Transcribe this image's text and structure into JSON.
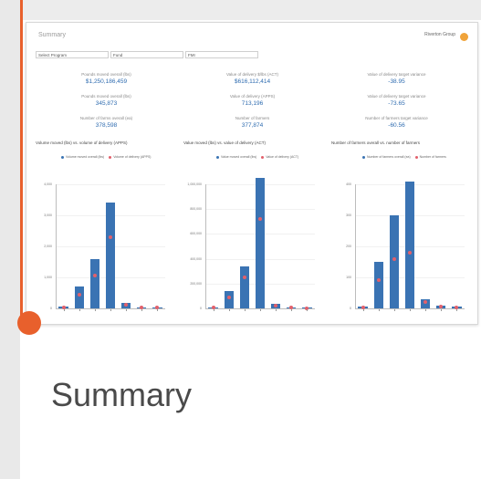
{
  "page": {
    "heading": "Summary"
  },
  "thumbnail": {
    "title": "Summary",
    "logo_text": "Riverton\nGroup",
    "filters": [
      {
        "label": "Select Program"
      },
      {
        "label": "Fund"
      },
      {
        "label": "FMI"
      }
    ],
    "kpis": [
      {
        "label": "Pounds moved overall (lbs)",
        "value": "$1,250,186,459"
      },
      {
        "label": "Value of delivery $/lbs (ACT)",
        "value": "$616,112,414"
      },
      {
        "label": "Value of delivery target variance",
        "value": "-38.95"
      },
      {
        "label": "Pounds moved overall (lbs)",
        "value": "345,873"
      },
      {
        "label": "Value of delivery (APPS)",
        "value": "713,196"
      },
      {
        "label": "Value of delivery target variance",
        "value": "-73.65"
      },
      {
        "label": "Number of farms overall (ea)",
        "value": "378,598"
      },
      {
        "label": "Number of farmers",
        "value": "377,874"
      },
      {
        "label": "Number of farmers target variance",
        "value": "-60.56"
      }
    ],
    "charts": [
      {
        "title": "Volume moved (lbs) vs. volume of delivery (APPS)",
        "legend": [
          "Volume moved overall (lbs)",
          "Volume of delivery (APPS)"
        ],
        "yticks": [
          "4,000",
          "3,000",
          "2,000",
          "1,000",
          "0"
        ]
      },
      {
        "title": "Value moved (lbs) vs. value of delivery (ACT)",
        "legend": [
          "Value moved overall (lbs)",
          "Value of delivery (ACT)"
        ],
        "yticks": [
          "1,000,000",
          "800,000",
          "600,000",
          "400,000",
          "200,000",
          "0"
        ]
      },
      {
        "title": "Number of farmers overall vs. number of farmers",
        "legend": [
          "Number of farmers overall (ea)",
          "Number of farmers"
        ],
        "yticks": [
          "400",
          "300",
          "200",
          "100",
          "0"
        ]
      }
    ],
    "chart_data": [
      {
        "type": "bar",
        "categories": [
          "1",
          "2",
          "3",
          "4",
          "5",
          "6",
          "7"
        ],
        "series": [
          {
            "name": "Volume moved overall (lbs)",
            "values": [
              50,
              700,
              1600,
              3400,
              180,
              40,
              20
            ]
          },
          {
            "name": "Volume of delivery (APPS)",
            "values": [
              20,
              450,
              1050,
              2300,
              130,
              30,
              15
            ]
          }
        ],
        "ylim": [
          0,
          4000
        ]
      },
      {
        "type": "bar",
        "categories": [
          "1",
          "2",
          "3",
          "4",
          "5",
          "6",
          "7"
        ],
        "series": [
          {
            "name": "Value moved overall (lbs)",
            "values": [
              10000,
              140000,
              340000,
              1050000,
              40000,
              10000,
              5000
            ]
          },
          {
            "name": "Value of delivery (ACT)",
            "values": [
              5000,
              90000,
              250000,
              720000,
              25000,
              6000,
              3000
            ]
          }
        ],
        "ylim": [
          0,
          1000000
        ]
      },
      {
        "type": "bar",
        "categories": [
          "1",
          "2",
          "3",
          "4",
          "5",
          "6",
          "7"
        ],
        "series": [
          {
            "name": "Number of farmers overall (ea)",
            "values": [
              5,
              150,
              300,
              410,
              30,
              10,
              5
            ]
          },
          {
            "name": "Number of farmers",
            "values": [
              3,
              90,
              160,
              180,
              20,
              6,
              3
            ]
          }
        ],
        "ylim": [
          0,
          400
        ]
      }
    ]
  },
  "colors": {
    "accent": "#e8602c",
    "bar": "#3a73b3",
    "marker": "#e2606b",
    "kpi_value": "#2f6cb0",
    "heading": "#4a4a4a"
  }
}
